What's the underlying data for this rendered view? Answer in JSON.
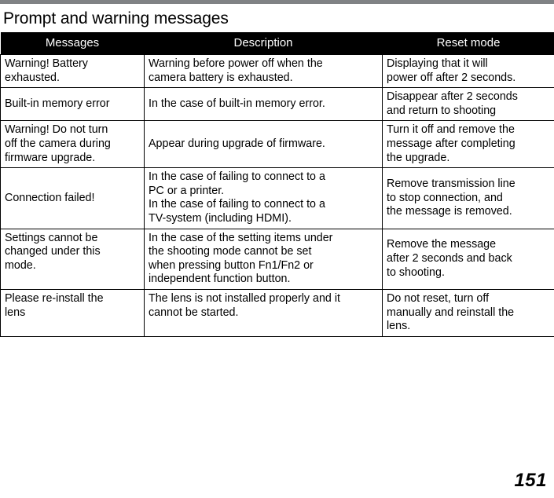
{
  "page": {
    "title": "Prompt and warning messages",
    "number": "151"
  },
  "table": {
    "headers": [
      "Messages",
      "Description",
      "Reset mode"
    ],
    "rows": [
      {
        "message": [
          "Warning! Battery",
          "exhausted."
        ],
        "message_align": "top",
        "description": [
          "Warning before power off when the",
          "camera battery is exhausted."
        ],
        "description_align": "top",
        "reset": [
          "Displaying that it will",
          "power off after 2 seconds."
        ],
        "reset_align": "top"
      },
      {
        "message": [
          "Built-in memory error"
        ],
        "message_align": "middle",
        "description": [
          "In the case of built-in memory error."
        ],
        "description_align": "middle",
        "reset": [
          "Disappear after 2 seconds",
          "and return to shooting"
        ],
        "reset_align": "top"
      },
      {
        "message": [
          "Warning! Do not turn",
          "off the camera during",
          "firmware upgrade."
        ],
        "message_align": "top",
        "description": [
          "Appear during upgrade of firmware."
        ],
        "description_align": "middle",
        "reset": [
          "Turn it off and remove the",
          "message after completing",
          "the upgrade."
        ],
        "reset_align": "top"
      },
      {
        "message": [
          "Connection failed!"
        ],
        "message_align": "middle",
        "description": [
          "In the case of failing to connect to a",
          "PC or a printer.",
          "In the case of failing to connect to a",
          "TV-system (including HDMI)."
        ],
        "description_align": "top",
        "reset": [
          "Remove transmission line",
          "to stop connection, and",
          "the message is removed."
        ],
        "reset_align": "middle"
      },
      {
        "message": [
          "Settings cannot be",
          "changed under this",
          "mode."
        ],
        "message_align": "top",
        "description": [
          "In the case of the setting items under",
          "the shooting mode cannot be set",
          "when pressing button Fn1/Fn2 or",
          "independent function button."
        ],
        "description_align": "top",
        "reset": [
          "Remove the message",
          "after 2 seconds and back",
          "to shooting."
        ],
        "reset_align": "middle"
      },
      {
        "message": [
          "Please re-install the",
          "lens"
        ],
        "message_align": "top",
        "description": [
          "The lens is not installed properly and it",
          "cannot be started."
        ],
        "description_align": "top",
        "reset": [
          "Do not reset, turn off",
          "manually and reinstall the",
          "lens."
        ],
        "reset_align": "top"
      }
    ]
  }
}
